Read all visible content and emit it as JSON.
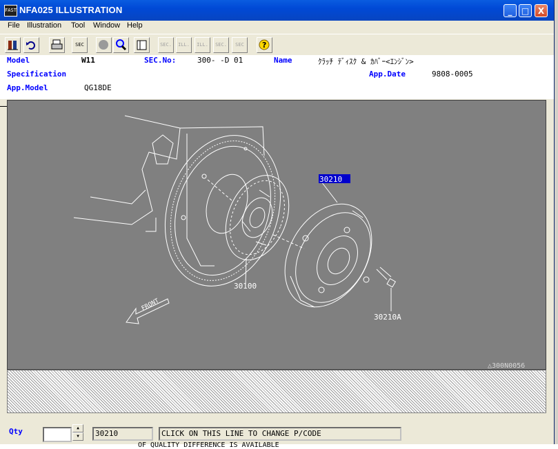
{
  "window": {
    "title": "NFA025  ILLUSTRATION",
    "icon_text": "FAST",
    "controls": {
      "minimize": "_",
      "maximize": "□",
      "close": "X"
    }
  },
  "menu": [
    "File",
    "Illustration",
    "Tool",
    "Window",
    "Help"
  ],
  "toolbar": {
    "buttons": [
      {
        "name": "parts-list-icon",
        "label": ""
      },
      {
        "name": "undo-icon",
        "label": ""
      },
      {
        "name": "print-icon",
        "label": ""
      },
      {
        "name": "sec-icon",
        "label": "SEC"
      },
      {
        "name": "circle-icon",
        "label": ""
      },
      {
        "name": "zoom-icon",
        "label": ""
      },
      {
        "name": "book-icon",
        "label": ""
      },
      {
        "name": "prev-sec-icon",
        "label": "SEC."
      },
      {
        "name": "prev-ill-icon",
        "label": "ILL."
      },
      {
        "name": "next-ill-icon",
        "label": "ILL."
      },
      {
        "name": "next-sec-icon",
        "label": "SEC."
      },
      {
        "name": "sec-query-icon",
        "label": "SEC"
      },
      {
        "name": "help-icon",
        "label": "?"
      }
    ]
  },
  "info": {
    "model_label": "Model",
    "model_value": "W11",
    "sec_label": "SEC.No:",
    "sec_value": "300-   -D 01",
    "name_label": "Name",
    "name_value": "ｸﾗｯﾁ ﾃﾞｨｽｸ & ｶﾊﾞｰ<ｴﾝｼﾞﾝ>",
    "spec_label": "Specification",
    "appdate_label": "App.Date",
    "appdate_value": "9808-0005",
    "appmodel_label": "App.Model",
    "appmodel_value": "QG18DE"
  },
  "illustration": {
    "callouts": {
      "selected": "30210",
      "disc": "30100",
      "bolt": "30210A"
    },
    "front_label": "FRONT",
    "ref_code": "△300N0056"
  },
  "bottom": {
    "qty_label": "Qty",
    "qty_value": "",
    "part_code": "30210",
    "message": "CLICK ON THIS LINE TO CHANGE P/CODE",
    "below_text": "OF QUALITY DIFFERENCE IS AVAILABLE"
  }
}
